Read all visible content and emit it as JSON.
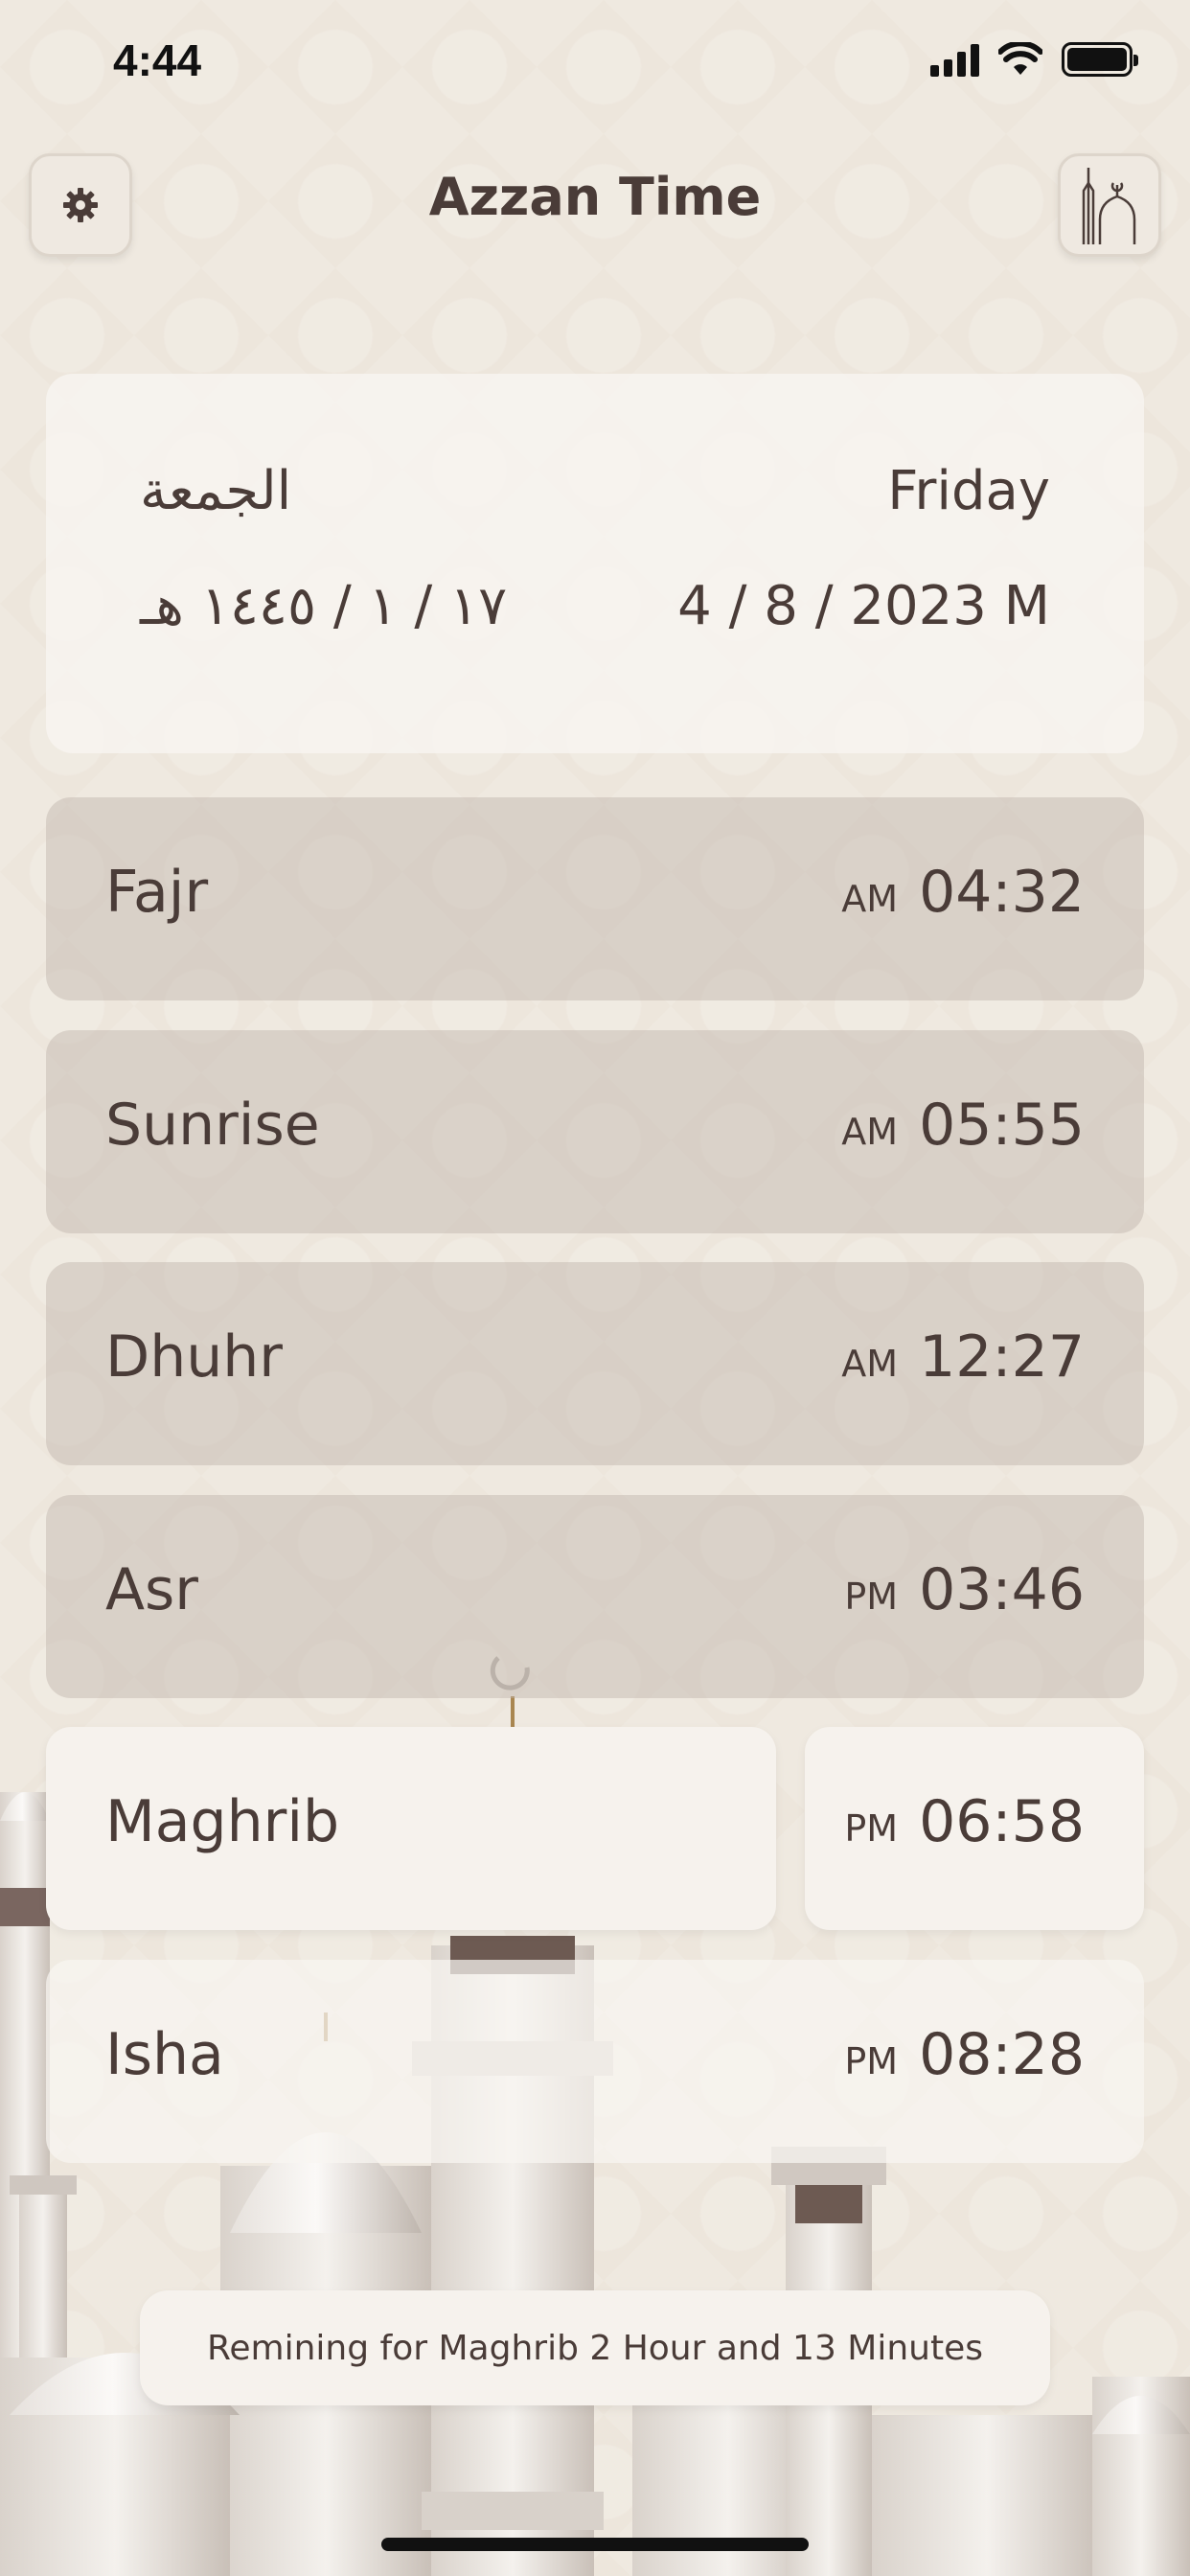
{
  "status_bar": {
    "time": "4:44"
  },
  "header": {
    "title": "Azzan Time"
  },
  "date_card": {
    "day_arabic": "الجمعة",
    "day_english": "Friday",
    "hijri_date": "١٧ / ١ / ١٤٤٥ هـ",
    "gregorian_date": "4 / 8 / 2023 M"
  },
  "prayers": [
    {
      "name": "Fajr",
      "period": "AM",
      "time": "04:32"
    },
    {
      "name": "Sunrise",
      "period": "AM",
      "time": "05:55"
    },
    {
      "name": "Dhuhr",
      "period": "AM",
      "time": "12:27"
    },
    {
      "name": "Asr",
      "period": "PM",
      "time": "03:46"
    },
    {
      "name": "Maghrib",
      "period": "PM",
      "time": "06:58"
    },
    {
      "name": "Isha",
      "period": "PM",
      "time": "08:28"
    }
  ],
  "remaining": {
    "text": "Remining for Maghrib 2 Hour and 13 Minutes"
  },
  "colors": {
    "text": "#4a3c38",
    "background": "#ede6dc",
    "card": "#f6f2ed"
  },
  "icons": {
    "settings": "gear-icon",
    "mosque": "mosque-icon"
  }
}
